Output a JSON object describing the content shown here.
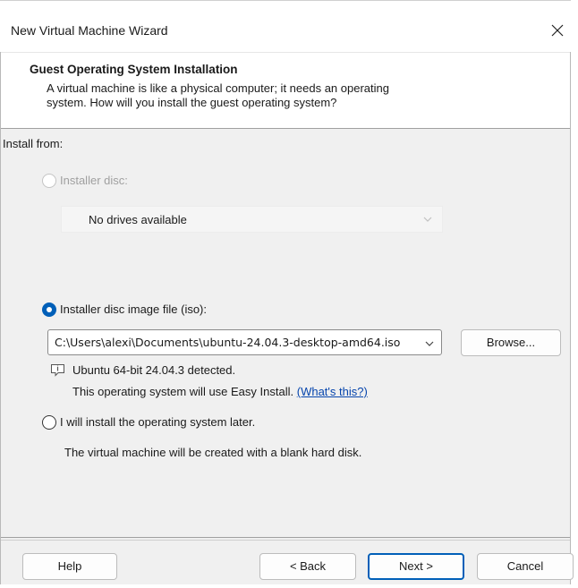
{
  "window": {
    "title": "New Virtual Machine Wizard",
    "close_icon": "close-icon"
  },
  "header": {
    "title": "Guest Operating System Installation",
    "description_line1": "A virtual machine is like a physical computer; it needs an operating",
    "description_line2": "system. How will you install the guest operating system?"
  },
  "install_from": {
    "label": "Install from:",
    "installer_disc": {
      "label": "Installer disc:",
      "enabled": false,
      "selected": false,
      "dropdown_value": "No drives available"
    },
    "iso": {
      "label": "Installer disc image file (iso):",
      "selected": true,
      "path": "C:\\Users\\alexi\\Documents\\ubuntu-24.04.3-desktop-amd64.iso",
      "browse_label": "Browse...",
      "detected": "Ubuntu 64-bit 24.04.3 detected.",
      "easy_install_text": "This operating system will use Easy Install.",
      "whats_this": "(What's this?)"
    },
    "later": {
      "label": "I will install the operating system later.",
      "selected": false,
      "description": "The virtual machine will be created with a blank hard disk."
    }
  },
  "footer": {
    "help": "Help",
    "back": "< Back",
    "next": "Next >",
    "cancel": "Cancel"
  },
  "colors": {
    "accent": "#005fb8",
    "link": "#0645ad",
    "disabled_text": "#a0a0a0",
    "dialog_bg": "#f0f0f0"
  }
}
